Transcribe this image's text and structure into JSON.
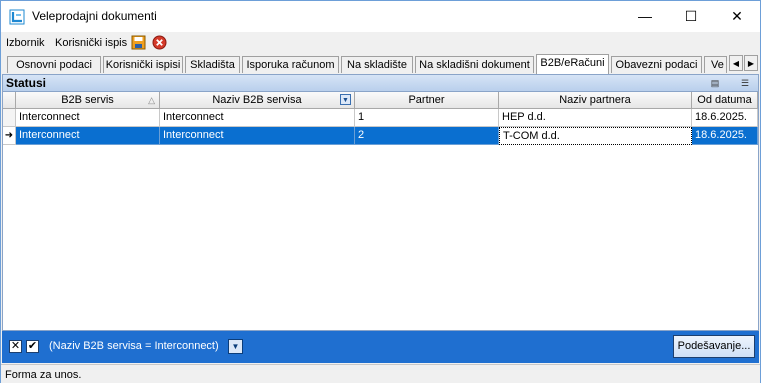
{
  "window": {
    "title": "Veleprodajni dokumenti",
    "minimize": "—",
    "maximize": "☐",
    "close": "✕"
  },
  "menu": {
    "items": [
      "Izbornik",
      "Korisnički ispis"
    ]
  },
  "toolbar": {
    "icons": [
      "save-icon",
      "delete-icon"
    ]
  },
  "tabs": [
    {
      "label": "Osnovni podaci",
      "active": false
    },
    {
      "label": "Korisnički ispisi",
      "active": false
    },
    {
      "label": "Skladišta",
      "active": false
    },
    {
      "label": "Isporuka računom",
      "active": false
    },
    {
      "label": "Na skladište",
      "active": false
    },
    {
      "label": "Na skladišni dokument",
      "active": false
    },
    {
      "label": "B2B/eRačuni",
      "active": true
    },
    {
      "label": "Obavezni podaci",
      "active": false
    },
    {
      "label": "Ve",
      "active": false
    }
  ],
  "tab_scroll": {
    "left": "◀",
    "right": "▶"
  },
  "panel": {
    "title": "Statusi",
    "icons": [
      "column-chooser-icon",
      "list-view-icon"
    ]
  },
  "grid": {
    "columns": [
      "B2B servis",
      "Naziv B2B servisa",
      "Partner",
      "Naziv partnera",
      "Od datuma"
    ],
    "rows": [
      {
        "b2b_servis": "Interconnect",
        "naziv_servisa": "Interconnect",
        "partner": "1",
        "naziv_partnera": "HEP d.d.",
        "od_datuma": "18.6.2025.",
        "selected": false
      },
      {
        "b2b_servis": "Interconnect",
        "naziv_servisa": "Interconnect",
        "partner": "2",
        "naziv_partnera": "T-COM d.d.",
        "od_datuma": "18.6.2025.",
        "selected": true
      }
    ],
    "row_indicator": "➜"
  },
  "filter": {
    "clear_glyph": "✕",
    "check_glyph": "✔",
    "text": "(Naziv B2B servisa = Interconnect)",
    "dropdown_glyph": "▼",
    "settings_label": "Podešavanje..."
  },
  "status": {
    "text": "Forma za unos."
  },
  "colors": {
    "selection": "#0a6fd0",
    "filter_bar": "#1f6fd0",
    "panel_header": "#c7d9f1"
  }
}
